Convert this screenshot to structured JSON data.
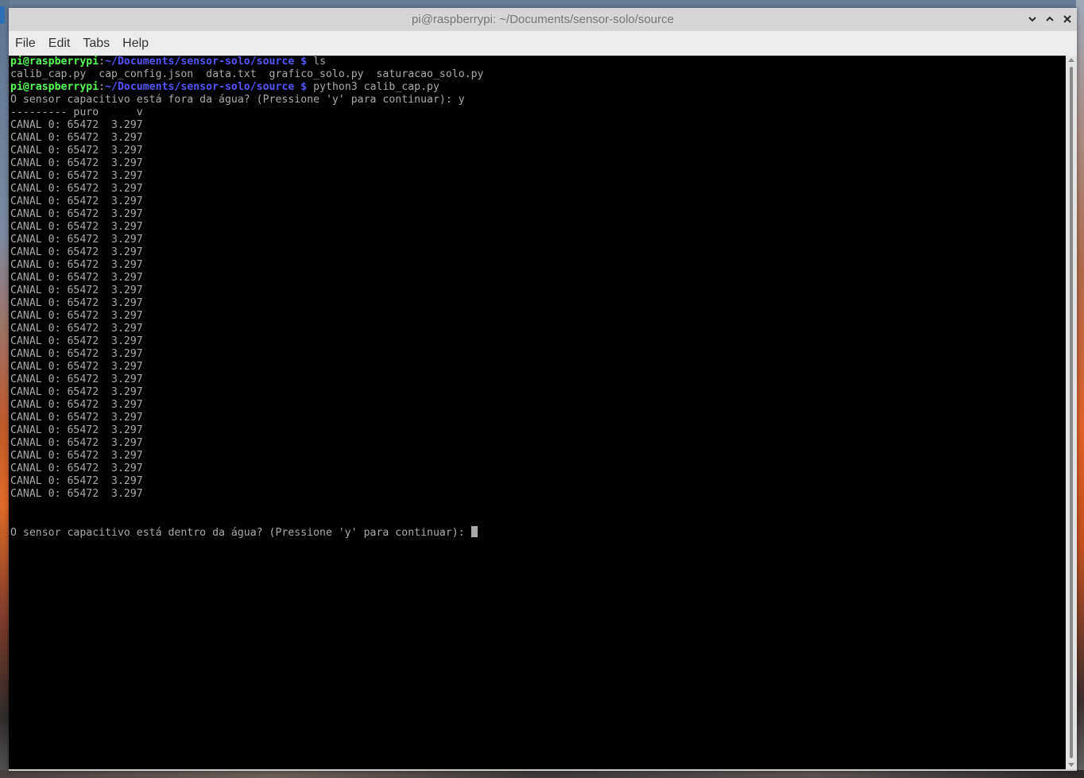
{
  "window": {
    "title": "pi@raspberrypi: ~/Documents/sensor-solo/source",
    "controls": {
      "minimize_icon": "chevron-down-icon",
      "maximize_icon": "chevron-up-icon",
      "close_icon": "close-icon"
    }
  },
  "menubar": {
    "items": [
      "File",
      "Edit",
      "Tabs",
      "Help"
    ]
  },
  "terminal": {
    "colors": {
      "background": "#000000",
      "foreground": "#aaaaaa",
      "prompt_user": "#55ff55",
      "prompt_path": "#5555ff"
    },
    "prompt_user": "pi@raspberrypi",
    "prompt_colon": ":",
    "prompt_path": "~/Documents/sensor-solo/source $",
    "lines": [
      {
        "kind": "prompt",
        "command": " ls"
      },
      {
        "kind": "text",
        "text": "calib_cap.py  cap_config.json  data.txt  grafico_solo.py  saturacao_solo.py"
      },
      {
        "kind": "prompt",
        "command": " python3 calib_cap.py"
      },
      {
        "kind": "text",
        "text": "O sensor capacitivo está fora da água? (Pressione 'y' para continuar): y"
      },
      {
        "kind": "text",
        "text": "--------- puro      v"
      },
      {
        "kind": "text",
        "text": "CANAL 0: 65472  3.297"
      },
      {
        "kind": "text",
        "text": "CANAL 0: 65472  3.297"
      },
      {
        "kind": "text",
        "text": "CANAL 0: 65472  3.297"
      },
      {
        "kind": "text",
        "text": "CANAL 0: 65472  3.297"
      },
      {
        "kind": "text",
        "text": "CANAL 0: 65472  3.297"
      },
      {
        "kind": "text",
        "text": "CANAL 0: 65472  3.297"
      },
      {
        "kind": "text",
        "text": "CANAL 0: 65472  3.297"
      },
      {
        "kind": "text",
        "text": "CANAL 0: 65472  3.297"
      },
      {
        "kind": "text",
        "text": "CANAL 0: 65472  3.297"
      },
      {
        "kind": "text",
        "text": "CANAL 0: 65472  3.297"
      },
      {
        "kind": "text",
        "text": "CANAL 0: 65472  3.297"
      },
      {
        "kind": "text",
        "text": "CANAL 0: 65472  3.297"
      },
      {
        "kind": "text",
        "text": "CANAL 0: 65472  3.297"
      },
      {
        "kind": "text",
        "text": "CANAL 0: 65472  3.297"
      },
      {
        "kind": "text",
        "text": "CANAL 0: 65472  3.297"
      },
      {
        "kind": "text",
        "text": "CANAL 0: 65472  3.297"
      },
      {
        "kind": "text",
        "text": "CANAL 0: 65472  3.297"
      },
      {
        "kind": "text",
        "text": "CANAL 0: 65472  3.297"
      },
      {
        "kind": "text",
        "text": "CANAL 0: 65472  3.297"
      },
      {
        "kind": "text",
        "text": "CANAL 0: 65472  3.297"
      },
      {
        "kind": "text",
        "text": "CANAL 0: 65472  3.297"
      },
      {
        "kind": "text",
        "text": "CANAL 0: 65472  3.297"
      },
      {
        "kind": "text",
        "text": "CANAL 0: 65472  3.297"
      },
      {
        "kind": "text",
        "text": "CANAL 0: 65472  3.297"
      },
      {
        "kind": "text",
        "text": "CANAL 0: 65472  3.297"
      },
      {
        "kind": "text",
        "text": "CANAL 0: 65472  3.297"
      },
      {
        "kind": "text",
        "text": "CANAL 0: 65472  3.297"
      },
      {
        "kind": "text",
        "text": "CANAL 0: 65472  3.297"
      },
      {
        "kind": "text",
        "text": "CANAL 0: 65472  3.297"
      },
      {
        "kind": "text",
        "text": "CANAL 0: 65472  3.297"
      },
      {
        "kind": "text",
        "text": ""
      },
      {
        "kind": "text",
        "text": ""
      },
      {
        "kind": "cursor",
        "text": "O sensor capacitivo está dentro da água? (Pressione 'y' para continuar): "
      }
    ]
  }
}
